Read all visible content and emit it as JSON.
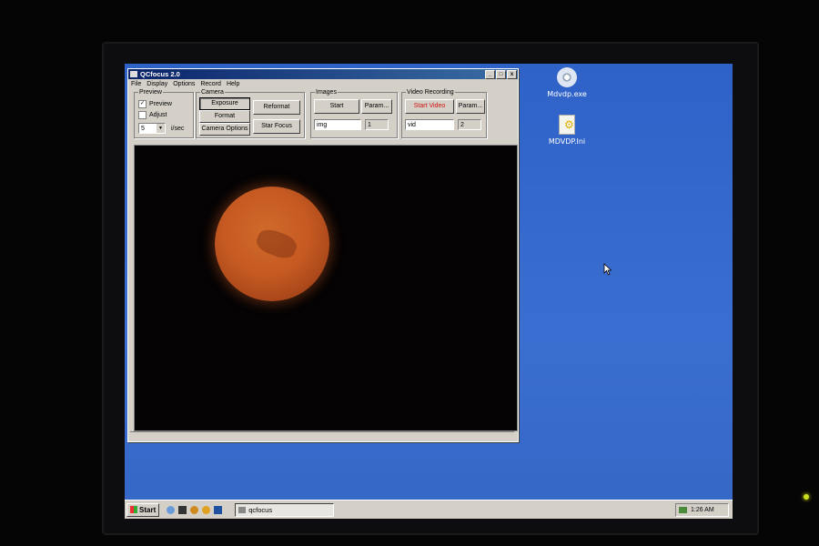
{
  "window": {
    "title": "QCfocus 2.0",
    "controls": {
      "minimize": "_",
      "maximize": "□",
      "close": "x"
    }
  },
  "menu": [
    "File",
    "Display",
    "Options",
    "Record",
    "Help"
  ],
  "preview": {
    "legend": "Preview",
    "preview_label": "Preview",
    "preview_checked": true,
    "adjust_label": "Adjust",
    "adjust_checked": false,
    "rate_value": "5",
    "rate_unit": "i/sec"
  },
  "camera": {
    "legend": "Camera",
    "exposure": "Exposure",
    "format": "Format",
    "camera_options": "Camera Options",
    "reformat": "Reformat",
    "star_focus": "Star Focus"
  },
  "images": {
    "legend": "Images",
    "start": "Start",
    "param": "Param...",
    "name_value": "img",
    "count_value": "1"
  },
  "video": {
    "legend": "Video Recording",
    "start": "Start Video",
    "param": "Param...",
    "name_value": "vid",
    "count_value": "2"
  },
  "desktop_icons": [
    {
      "label": "Mdvdp.exe",
      "icon": "cd-icon"
    },
    {
      "label": "MDVDP.Ini",
      "icon": "settings-file-icon"
    }
  ],
  "taskbar": {
    "start": "Start",
    "task": "qcfocus",
    "clock": "1:26 AM"
  },
  "colors": {
    "desktop": "#3a6ed0",
    "titlebar": "#0a246a",
    "mars": "#c65a22",
    "video_start_text": "#d01010"
  }
}
